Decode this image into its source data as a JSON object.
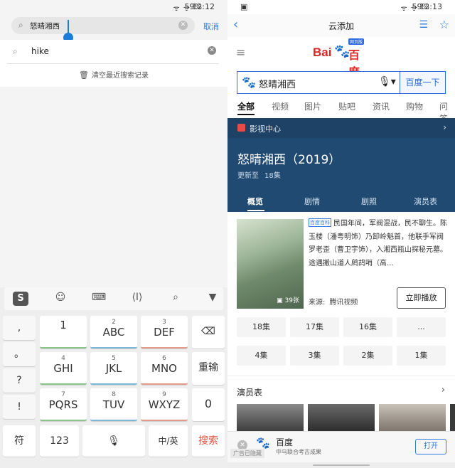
{
  "left": {
    "status": {
      "signal": "ᯤ ᯤ",
      "battery": "59%",
      "time": "12:12"
    },
    "search": {
      "value": "怒晴湘西",
      "cancel_label": "取消"
    },
    "history": {
      "items": [
        "hike"
      ],
      "clear_label": "清空最近搜索记录"
    },
    "keyboard": {
      "toolbar": {
        "logo": "S"
      },
      "side_keys": [
        ",",
        "。",
        "?",
        "!"
      ],
      "keys": [
        {
          "sub": "",
          "main": "1"
        },
        {
          "sub": "2",
          "main": "ABC"
        },
        {
          "sub": "3",
          "main": "DEF"
        },
        {
          "sub": "4",
          "main": "GHI"
        },
        {
          "sub": "5",
          "main": "JKL"
        },
        {
          "sub": "6",
          "main": "MNO"
        },
        {
          "sub": "7",
          "main": "PQRS"
        },
        {
          "sub": "8",
          "main": "TUV"
        },
        {
          "sub": "9",
          "main": "WXYZ"
        }
      ],
      "rekey_label": "重输",
      "zero_label": "0",
      "bottom": {
        "symbol": "符",
        "num": "123",
        "lang": "中/英",
        "search": "搜索"
      }
    }
  },
  "right": {
    "status": {
      "battery": "59%",
      "time": "12:13"
    },
    "nav": {
      "title": "云添加"
    },
    "logo": {
      "bai": "Bai",
      "du": "百度",
      "tag": "网页版"
    },
    "search": {
      "query": "怒晴湘西",
      "button": "百度一下"
    },
    "tabs": [
      "全部",
      "视频",
      "图片",
      "贴吧",
      "资讯",
      "购物",
      "问答"
    ],
    "card": {
      "section_label": "影视中心",
      "title": "怒晴湘西（2019）",
      "update_label": "更新至",
      "update_value": "18集",
      "tabs": [
        "概览",
        "剧情",
        "剧照",
        "演员表"
      ]
    },
    "detail": {
      "badge": "百度百科",
      "description": "民国年间，军阀混战，民不聊生。陈玉楼（潘粤明饰）乃卸岭魁首，他联手军阀罗老歪（曹卫宇饰），入湘西瓶山探秘元墓。途遇搬山道人鹧鸪哨（高...",
      "poster_count": "39张",
      "source_label": "来源:",
      "source_value": "腾讯视频",
      "play_label": "立即播放"
    },
    "episodes": [
      [
        "18集",
        "17集",
        "16集",
        "..."
      ],
      [
        "4集",
        "3集",
        "2集",
        "1集"
      ]
    ],
    "cast_label": "演员表",
    "ad": {
      "name": "百度",
      "desc": "中乌联合考古成果",
      "hidden_label": "广告已隐藏",
      "open_label": "打开"
    }
  },
  "colors": {
    "accent": "#2d7be0",
    "card_bg": "#214a72",
    "brand_red": "#e02424",
    "search_red": "#e8503a"
  }
}
